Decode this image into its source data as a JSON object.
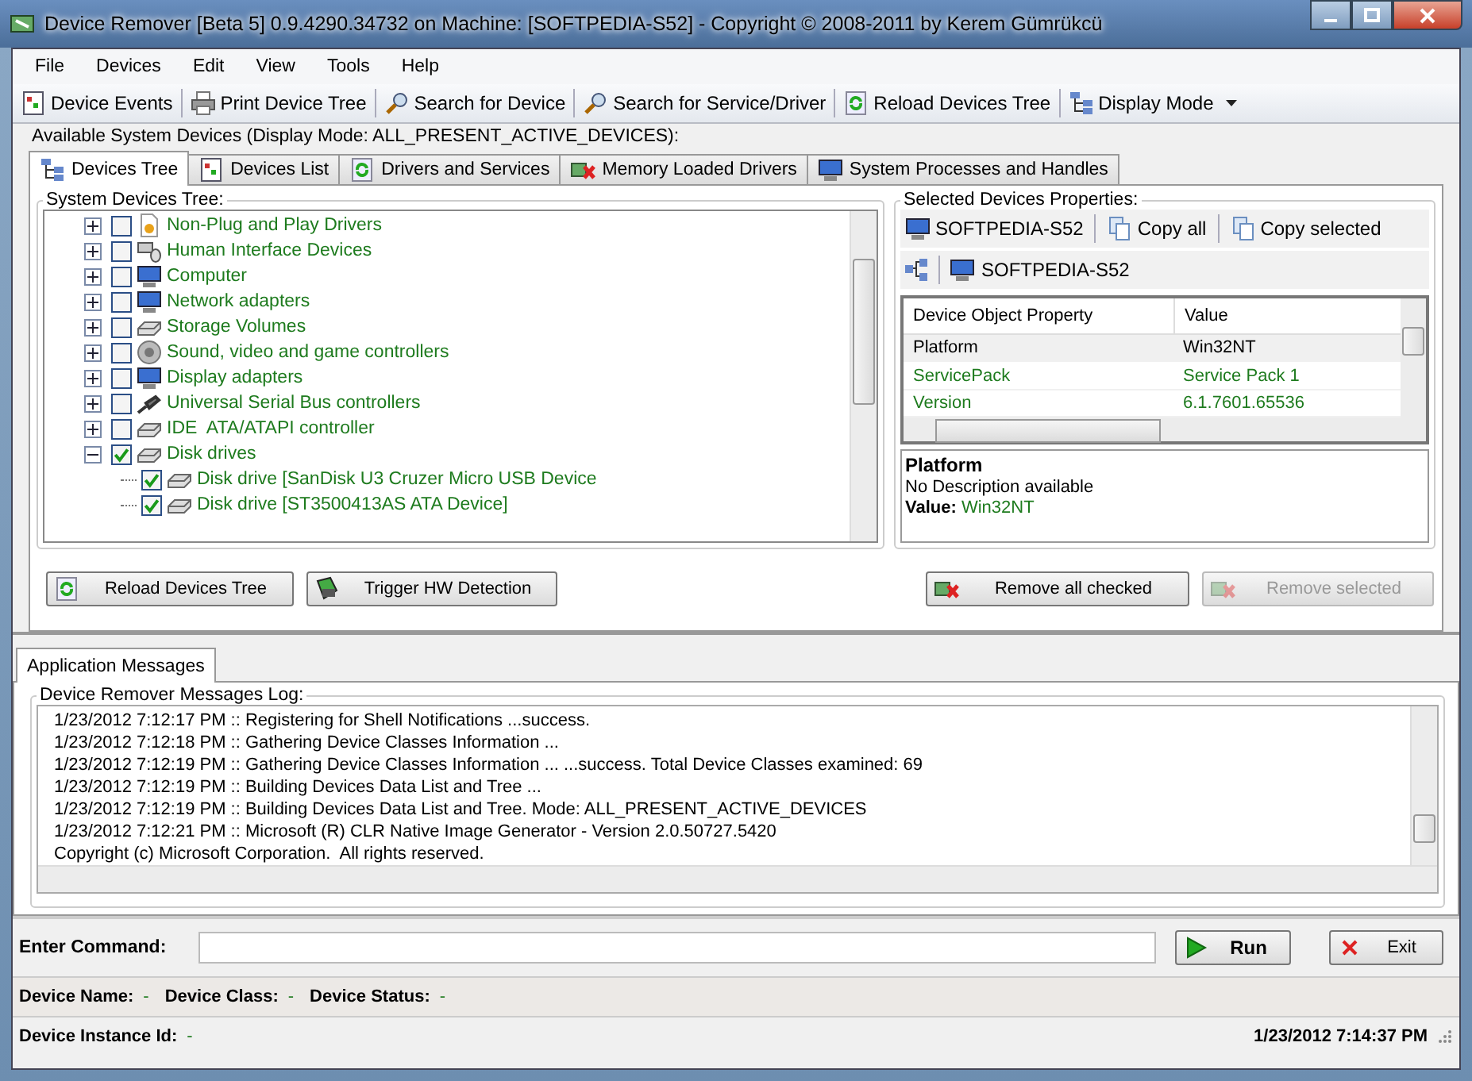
{
  "window": {
    "title": "Device Remover [Beta 5] 0.9.4290.34732 on Machine: [SOFTPEDIA-S52] - Copyright © 2008-2011 by Kerem Gümrükcü"
  },
  "menu": [
    "File",
    "Devices",
    "Edit",
    "View",
    "Tools",
    "Help"
  ],
  "toolbar": [
    {
      "label": "Device Events",
      "kind": "events"
    },
    {
      "label": "Print Device Tree",
      "kind": "print"
    },
    {
      "label": "Search for Device",
      "kind": "search"
    },
    {
      "label": "Search for Service/Driver",
      "kind": "search"
    },
    {
      "label": "Reload Devices Tree",
      "kind": "reload"
    },
    {
      "label": "Display Mode",
      "kind": "dropdown"
    }
  ],
  "devices_panel": {
    "title": "Available System Devices (Display Mode: ALL_PRESENT_ACTIVE_DEVICES):",
    "tabs": [
      {
        "label": "Devices Tree",
        "selected": true
      },
      {
        "label": "Devices List",
        "selected": false
      },
      {
        "label": "Drivers and Services",
        "selected": false
      },
      {
        "label": "Memory Loaded Drivers",
        "selected": false
      },
      {
        "label": "System Processes and Handles",
        "selected": false
      }
    ],
    "tree": {
      "title": "System Devices Tree:",
      "items": [
        {
          "label": "Non-Plug and Play Drivers",
          "kind": "doc",
          "checked": false,
          "expanded": false
        },
        {
          "label": "Human Interface Devices",
          "kind": "hid",
          "checked": false,
          "expanded": false
        },
        {
          "label": "Computer",
          "kind": "computer",
          "checked": false,
          "expanded": false
        },
        {
          "label": "Network adapters",
          "kind": "computer",
          "checked": false,
          "expanded": false
        },
        {
          "label": "Storage Volumes",
          "kind": "drive",
          "checked": false,
          "expanded": false
        },
        {
          "label": "Sound, video and game controllers",
          "kind": "sound",
          "checked": false,
          "expanded": false
        },
        {
          "label": "Display adapters",
          "kind": "computer",
          "checked": false,
          "expanded": false
        },
        {
          "label": "Universal Serial Bus controllers",
          "kind": "usb",
          "checked": false,
          "expanded": false
        },
        {
          "label": "IDE  ATA/ATAPI controller",
          "kind": "drive",
          "checked": false,
          "expanded": false
        },
        {
          "label": "Disk drives",
          "kind": "drive",
          "checked": true,
          "expanded": true,
          "children": [
            {
              "label": "Disk drive [SanDisk U3 Cruzer Micro USB Device",
              "kind": "drive",
              "checked": true
            },
            {
              "label": "Disk drive [ST3500413AS ATA Device]",
              "kind": "drive",
              "checked": true
            }
          ]
        }
      ]
    },
    "properties": {
      "title": "Selected Devices Properties:",
      "toolbar": [
        {
          "label": "SOFTPEDIA-S52",
          "kind": "computer"
        },
        {
          "label": "Copy all",
          "kind": "copy"
        },
        {
          "label": "Copy selected",
          "kind": "copy"
        }
      ],
      "path": "SOFTPEDIA-S52",
      "columns": [
        "Device Object Property",
        "Value"
      ],
      "rows": [
        {
          "cells": [
            "Platform",
            "Win32NT"
          ],
          "selected": true
        },
        {
          "cells": [
            "ServicePack",
            "Service Pack 1"
          ],
          "selected": false
        },
        {
          "cells": [
            "Version",
            "6.1.7601.65536"
          ],
          "selected": false
        }
      ],
      "description": {
        "title": "Platform",
        "text": "No Description available",
        "value_label": "Value:",
        "value": "Win32NT"
      }
    },
    "buttons": [
      {
        "label": "Reload Devices Tree",
        "kind": "reload",
        "disabled": false
      },
      {
        "label": "Trigger HW Detection",
        "kind": "trigger",
        "disabled": false
      },
      {
        "label": "Remove all checked",
        "kind": "remove",
        "disabled": false
      },
      {
        "label": "Remove selected",
        "kind": "remove",
        "disabled": true
      }
    ]
  },
  "messages": {
    "tab": {
      "label": "Application Messages",
      "selected": true
    },
    "title": "Device Remover Messages Log:",
    "lines": [
      "1/23/2012 7:12:17 PM :: Registering for Shell Notifications ...success.",
      "1/23/2012 7:12:18 PM :: Gathering Device Classes Information ...",
      "1/23/2012 7:12:19 PM :: Gathering Device Classes Information ... ...success. Total Device Classes examined: 69",
      "1/23/2012 7:12:19 PM :: Building Devices Data List and Tree ...",
      "1/23/2012 7:12:19 PM :: Building Devices Data List and Tree. Mode: ALL_PRESENT_ACTIVE_DEVICES",
      "1/23/2012 7:12:21 PM :: Microsoft (R) CLR Native Image Generator - Version 2.0.50727.5420",
      "Copyright (c) Microsoft Corporation.  All rights reserved."
    ]
  },
  "command": {
    "label": "Enter Command:",
    "buttons": [
      {
        "label": "Run",
        "kind": "run"
      },
      {
        "label": "Exit",
        "kind": "exit"
      }
    ]
  },
  "status": {
    "fields": [
      {
        "label": "Device Name:",
        "value": "-"
      },
      {
        "label": "Device Class:",
        "value": "-"
      },
      {
        "label": "Device Status:",
        "value": "-"
      }
    ],
    "instance": {
      "label": "Device Instance Id:",
      "value": "-"
    },
    "time": "1/23/2012 7:14:37 PM"
  }
}
